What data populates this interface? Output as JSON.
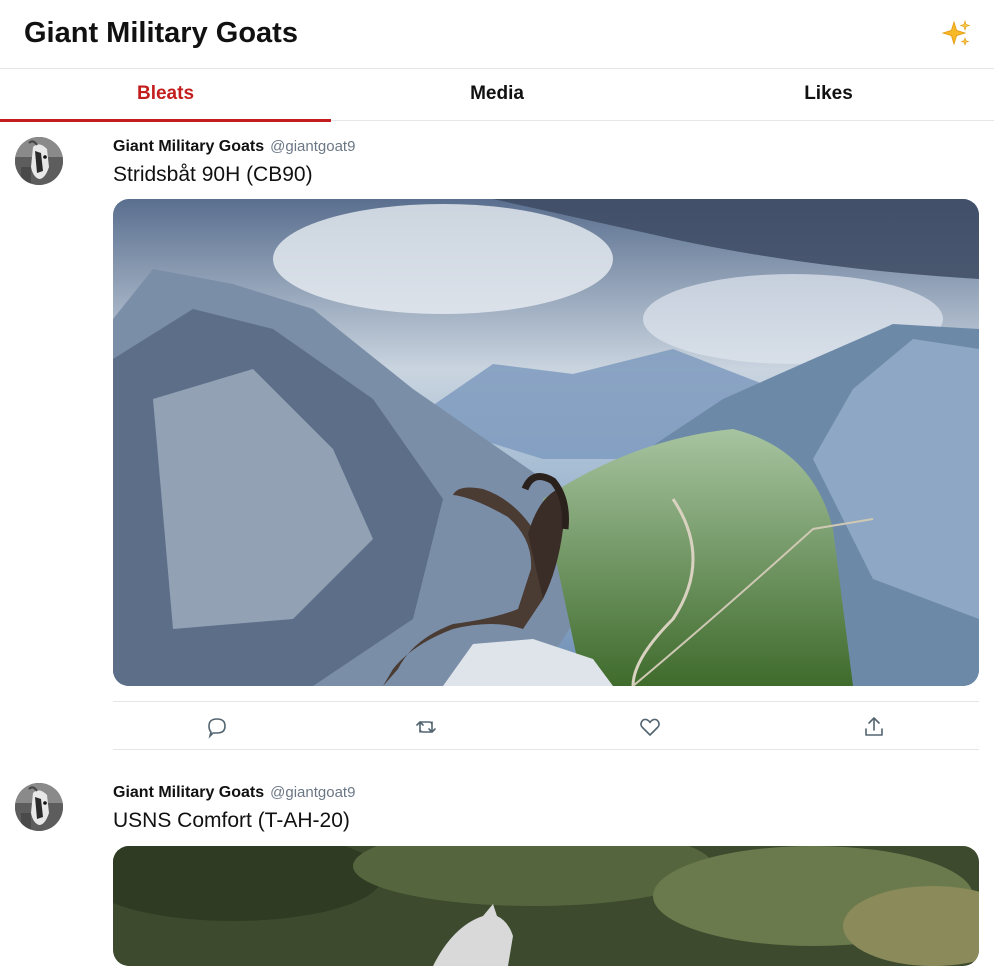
{
  "header": {
    "title": "Giant Military Goats",
    "sparkle_icon": "sparkle-icon"
  },
  "tabs": [
    {
      "label": "Bleats",
      "active": true
    },
    {
      "label": "Media",
      "active": false
    },
    {
      "label": "Likes",
      "active": false
    }
  ],
  "tweets": [
    {
      "display_name": "Giant Military Goats",
      "handle": "@giantgoat9",
      "text": "Stridsbåt 90H (CB90)",
      "media": "ibex on mountain ridge overlooking green valley"
    },
    {
      "display_name": "Giant Military Goats",
      "handle": "@giantgoat9",
      "text": "USNS Comfort (T-AH-20)",
      "media": "white goat in forest"
    }
  ],
  "actions": [
    "reply-icon",
    "rebleat-icon",
    "like-icon",
    "share-icon"
  ],
  "colors": {
    "accent": "#c41d1d",
    "icon": "#536471",
    "divider": "#e6e6e6"
  }
}
